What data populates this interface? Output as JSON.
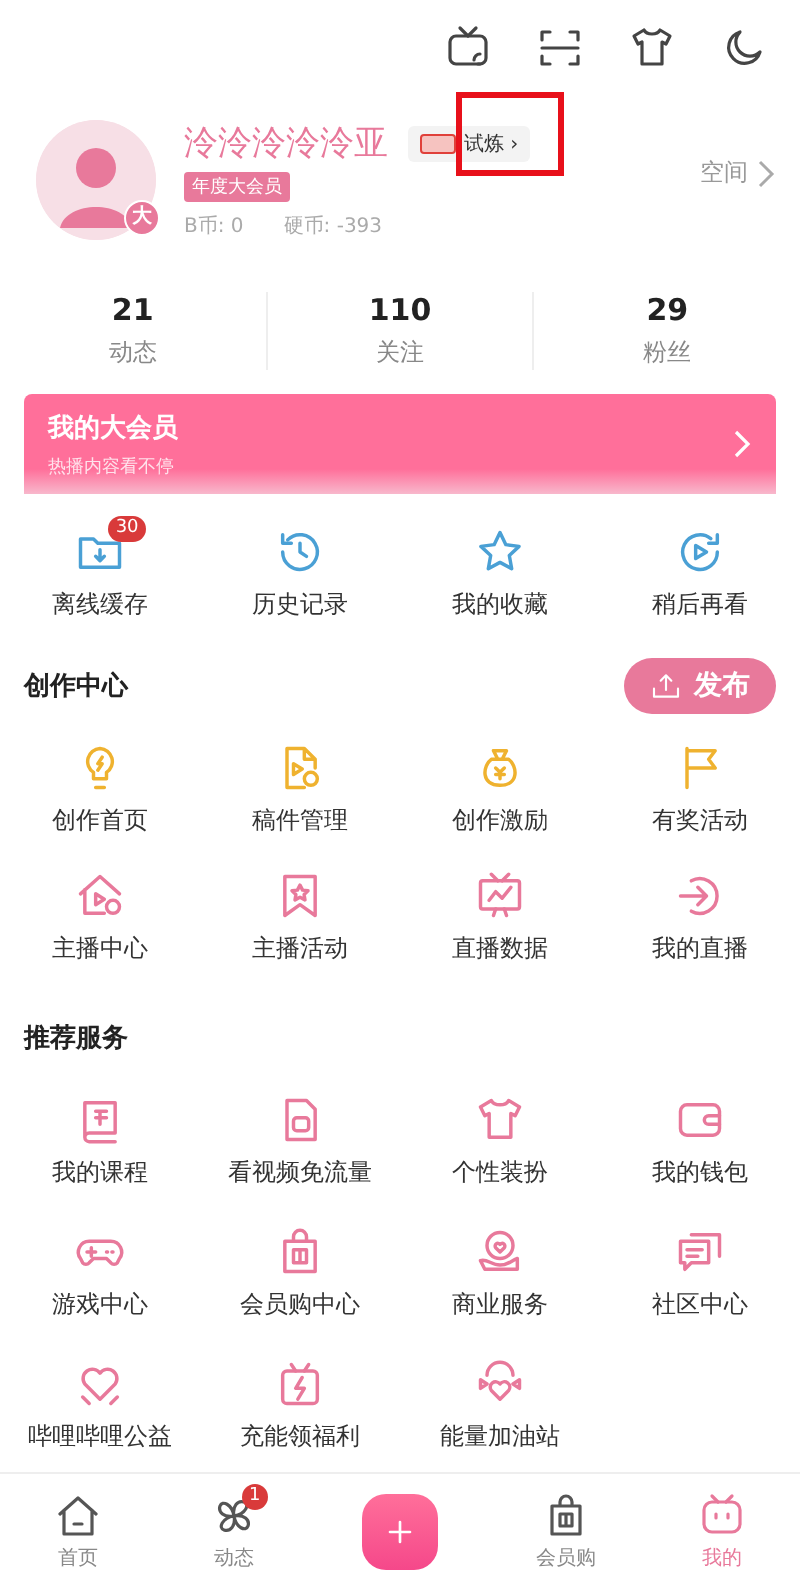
{
  "profile": {
    "name": "泠泠泠泠泠亚",
    "trial_label": "试炼",
    "trial_chevron": "›",
    "trial_highlighted": true,
    "vip_tag": "年度大会员",
    "avatar_badge": "大",
    "b_coins": "B币: 0",
    "coins": "硬币: -393",
    "space_link": "空间"
  },
  "stats": [
    {
      "value": "21",
      "label": "动态"
    },
    {
      "value": "110",
      "label": "关注"
    },
    {
      "value": "29",
      "label": "粉丝"
    }
  ],
  "vip_banner": {
    "title": "我的大会员",
    "subtitle": "热播内容看不停"
  },
  "quick_actions": [
    {
      "label": "离线缓存",
      "badge": "30"
    },
    {
      "label": "历史记录"
    },
    {
      "label": "我的收藏"
    },
    {
      "label": "稍后再看"
    }
  ],
  "creation_center": {
    "title": "创作中心",
    "publish_button": "发布",
    "items": [
      "创作首页",
      "稿件管理",
      "创作激励",
      "有奖活动",
      "主播中心",
      "主播活动",
      "直播数据",
      "我的直播"
    ]
  },
  "recommended_services": {
    "title": "推荐服务",
    "items": [
      "我的课程",
      "看视频免流量",
      "个性装扮",
      "我的钱包",
      "游戏中心",
      "会员购中心",
      "商业服务",
      "社区中心",
      "哔哩哔哩公益",
      "充能领福利",
      "能量加油站"
    ]
  },
  "bottom_nav": [
    {
      "kind": "tab",
      "label": "首页",
      "selected": false
    },
    {
      "kind": "tab",
      "label": "动态",
      "selected": false,
      "badge": "1"
    },
    {
      "kind": "plus"
    },
    {
      "kind": "tab",
      "label": "会员购",
      "selected": false
    },
    {
      "kind": "tab",
      "label": "我的",
      "selected": true
    }
  ]
}
